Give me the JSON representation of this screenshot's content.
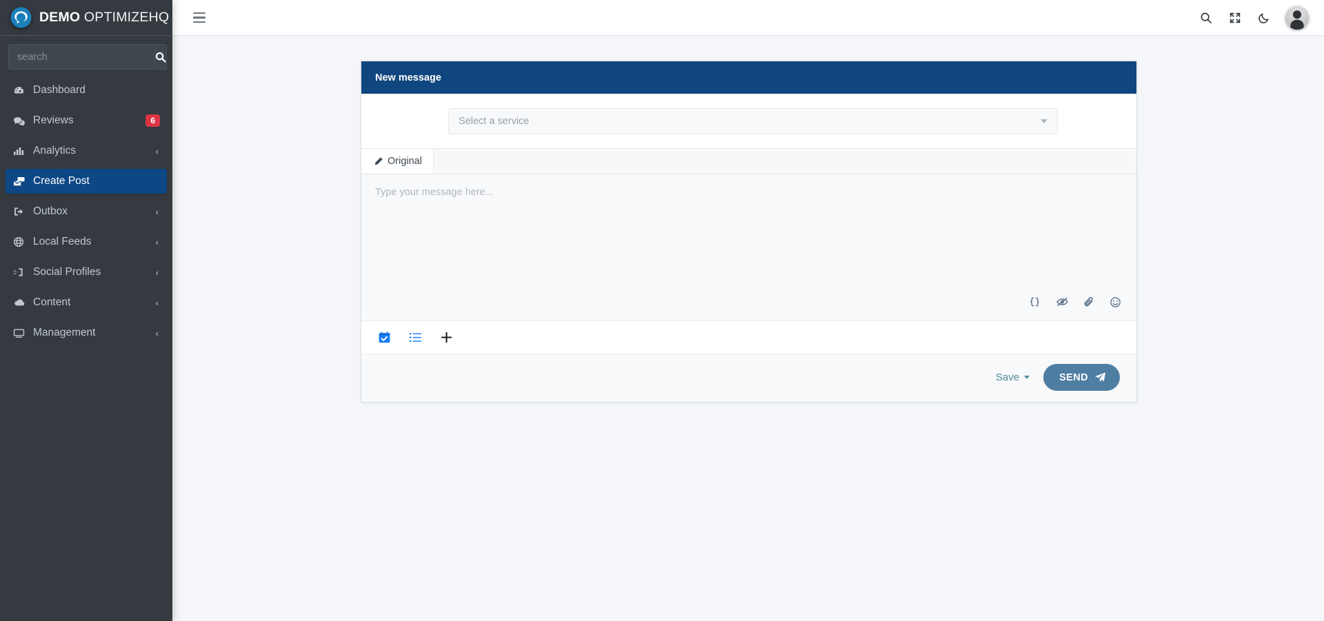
{
  "brand": {
    "name_bold": "DEMO",
    "name_light": " OPTIMIZEHQ",
    "logo_icon": "chat-bubble-circle-logo"
  },
  "sidebar": {
    "search": {
      "placeholder": "search",
      "value": "",
      "button_icon": "search-icon"
    },
    "items": [
      {
        "label": "Dashboard",
        "icon": "tachometer-icon",
        "active": false,
        "chevron": "",
        "badge": ""
      },
      {
        "label": "Reviews",
        "icon": "comments-icon",
        "active": false,
        "chevron": "",
        "badge": "6"
      },
      {
        "label": "Analytics",
        "icon": "chart-bar-icon",
        "active": false,
        "chevron": "‹",
        "badge": ""
      },
      {
        "label": "Create Post",
        "icon": "mail-bulk-icon",
        "active": true,
        "chevron": "",
        "badge": ""
      },
      {
        "label": "Outbox",
        "icon": "sign-out-icon",
        "active": false,
        "chevron": "‹",
        "badge": ""
      },
      {
        "label": "Local Feeds",
        "icon": "globe-icon",
        "active": false,
        "chevron": "‹",
        "badge": ""
      },
      {
        "label": "Social Profiles",
        "icon": "sign-in-icon",
        "active": false,
        "chevron": "‹",
        "badge": ""
      },
      {
        "label": "Content",
        "icon": "cloud-icon",
        "active": false,
        "chevron": "‹",
        "badge": ""
      },
      {
        "label": "Management",
        "icon": "desktop-icon",
        "active": false,
        "chevron": "‹",
        "badge": ""
      }
    ]
  },
  "topbar": {
    "menu_icon": "hamburger-menu-icon",
    "search_icon": "search-icon",
    "fullscreen_icon": "expand-arrows-icon",
    "darkmode_icon": "moon-icon",
    "avatar_icon": "user-avatar"
  },
  "card": {
    "title": "New message",
    "header_color": "#10467f",
    "service_select": {
      "placeholder": "Select a service",
      "value": "",
      "caret_icon": "chevron-down-icon"
    },
    "tabs": [
      {
        "label": "Original",
        "icon": "pencil-icon",
        "active": true
      }
    ],
    "editor": {
      "placeholder": "Type your message here...",
      "value": ""
    },
    "editor_tools": [
      {
        "name": "variables-icon",
        "title": "{}"
      },
      {
        "name": "eye-slash-icon",
        "title": ""
      },
      {
        "name": "paperclip-icon",
        "title": ""
      },
      {
        "name": "emoji-icon",
        "title": ""
      }
    ],
    "actions": [
      {
        "name": "schedule-calendar-icon",
        "color": "#1a7ef5"
      },
      {
        "name": "queue-list-icon",
        "color": "#1a7ef5"
      },
      {
        "name": "add-plus-icon",
        "color": "#1c1c1c"
      }
    ],
    "footer": {
      "save_label": "Save",
      "save_caret_icon": "chevron-down-icon",
      "send_label": "SEND",
      "send_icon": "paper-plane-icon",
      "send_color": "#4f7ea3"
    }
  }
}
